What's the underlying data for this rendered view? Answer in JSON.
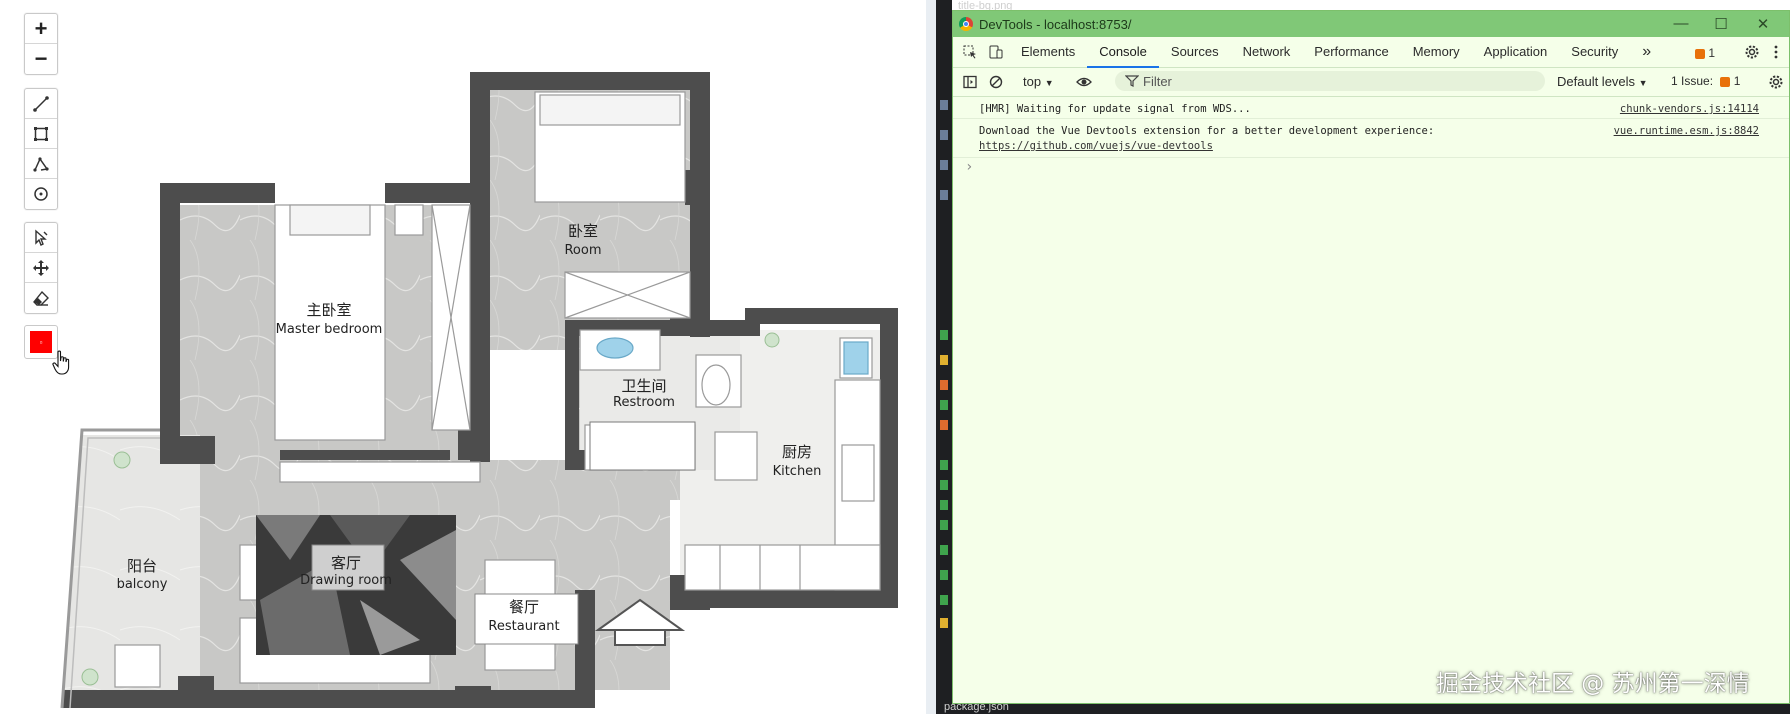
{
  "map": {
    "zoom_in_label": "+",
    "zoom_out_label": "−",
    "tools": [
      "draw-line",
      "draw-rectangle",
      "draw-polygon",
      "draw-circle",
      "select",
      "move",
      "erase"
    ],
    "color_tool": {
      "color": "#ff0000"
    },
    "rooms": {
      "master_cn": "主卧室",
      "master_en": "Master bedroom",
      "room_cn": "卧室",
      "room_en": "Room",
      "restroom_cn": "卫生间",
      "restroom_en": "Restroom",
      "kitchen_cn": "厨房",
      "kitchen_en": "Kitchen",
      "balcony_cn": "阳台",
      "balcony_en": "balcony",
      "drawing_cn": "客厅",
      "drawing_en": "Drawing room",
      "restaurant_cn": "餐厅",
      "restaurant_en": "Restaurant"
    }
  },
  "devtools": {
    "window_title": "DevTools - localhost:8753/",
    "tabs": [
      "Elements",
      "Console",
      "Sources",
      "Network",
      "Performance",
      "Memory",
      "Application",
      "Security"
    ],
    "active_tab": "Console",
    "more_tabs": "»",
    "issues_count": "1",
    "toolbar": {
      "context": "top",
      "filter_placeholder": "Filter",
      "levels": "Default levels",
      "issues": "1 Issue:",
      "issues_num": "1"
    },
    "console": [
      {
        "text": "[HMR] Waiting for update signal from WDS...",
        "source": "chunk-vendors.js:14114"
      },
      {
        "text": "Download the Vue Devtools extension for a better development experience:",
        "source": "vue.runtime.esm.js:8842",
        "link": "https://github.com/vuejs/vue-devtools"
      }
    ],
    "prompt": "›"
  },
  "editor": {
    "top_file": "title-bg.png",
    "bottom_file": "package.json"
  },
  "watermark": "掘金技术社区 @ 苏州第一深情"
}
